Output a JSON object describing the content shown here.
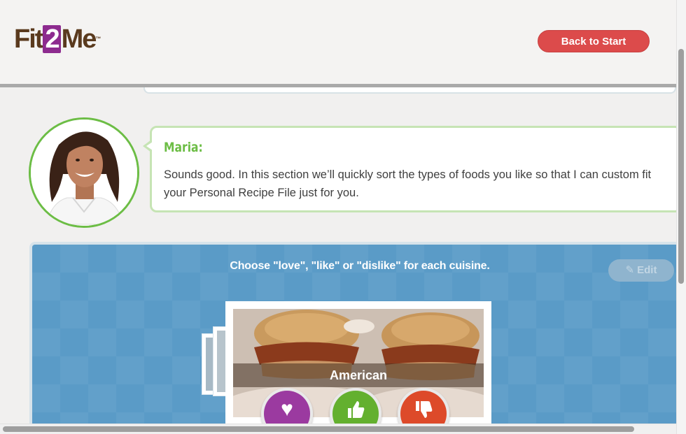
{
  "header": {
    "logo": {
      "part1": "Fit",
      "part2": "2",
      "part3": "Me",
      "tm": "™"
    },
    "back_button": "Back to Start"
  },
  "chat": {
    "speaker": "Maria:",
    "message": "Sounds good. In this section we’ll quickly sort the types of foods you like so that I can custom fit your Personal Recipe File just for you."
  },
  "panel": {
    "instruction": "Choose \"love\", \"like\" or \"dislike\" for each cuisine.",
    "edit_button": "Edit",
    "card": {
      "cuisine": "American"
    },
    "votes": [
      {
        "name": "love",
        "icon": "heart-icon",
        "color": "#9b3aa0"
      },
      {
        "name": "like",
        "icon": "thumbs-up-icon",
        "color": "#63b02f"
      },
      {
        "name": "dislike",
        "icon": "thumbs-down-icon",
        "color": "#dd4a2a"
      }
    ]
  },
  "colors": {
    "accent_green": "#6cbd45",
    "brand_purple": "#8d2b8f",
    "back_button_red": "#dc4b4b",
    "panel_blue": "#5a9bc7"
  }
}
